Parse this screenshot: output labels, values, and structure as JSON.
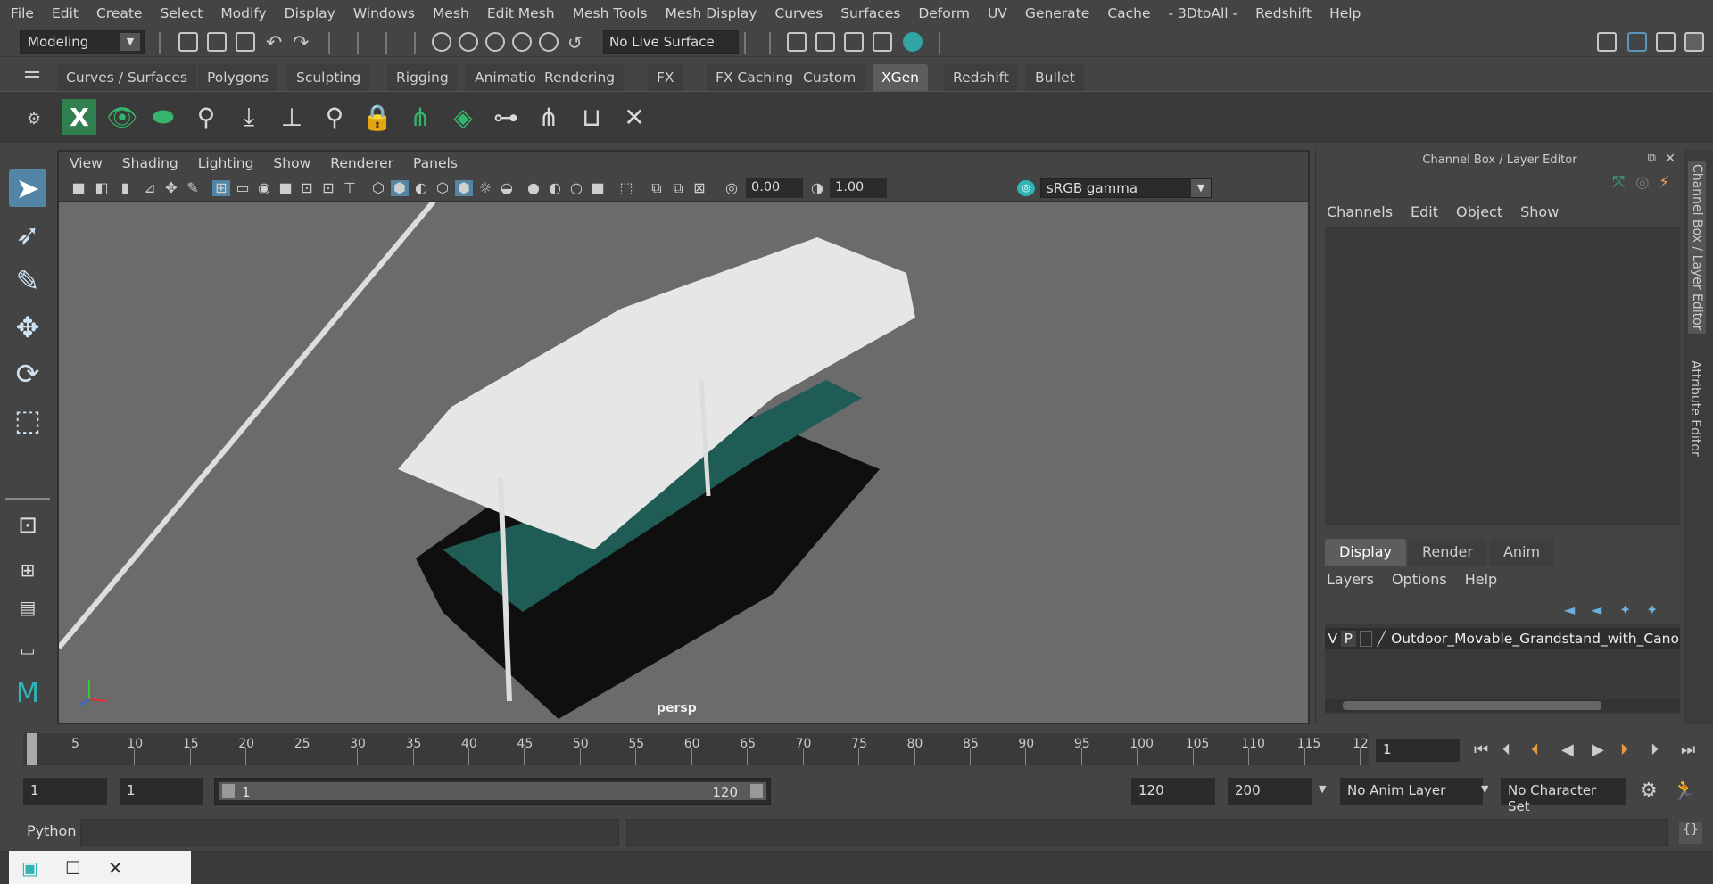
{
  "menubar": [
    "File",
    "Edit",
    "Create",
    "Select",
    "Modify",
    "Display",
    "Windows",
    "Mesh",
    "Edit Mesh",
    "Mesh Tools",
    "Mesh Display",
    "Curves",
    "Surfaces",
    "Deform",
    "UV",
    "Generate",
    "Cache",
    "- 3DtoAll -",
    "Redshift",
    "Help"
  ],
  "status": {
    "mode": "Modeling",
    "live_surface": "No Live Surface"
  },
  "shelf_tabs": [
    "Curves / Surfaces",
    "Polygons",
    "Sculpting",
    "Rigging",
    "Animation",
    "Rendering",
    "FX",
    "FX Caching",
    "Custom",
    "XGen",
    "Redshift",
    "Bullet"
  ],
  "shelf_active": "XGen",
  "viewport": {
    "menu": [
      "View",
      "Shading",
      "Lighting",
      "Show",
      "Renderer",
      "Panels"
    ],
    "exposure": "0.00",
    "gamma_value": "1.00",
    "color_space": "sRGB gamma",
    "camera": "persp"
  },
  "right_panel": {
    "title": "Channel Box / Layer Editor",
    "menu": [
      "Channels",
      "Edit",
      "Object",
      "Show"
    ],
    "display_tabs": [
      "Display",
      "Render",
      "Anim"
    ],
    "layer_menu": [
      "Layers",
      "Options",
      "Help"
    ],
    "layer": {
      "v": "V",
      "p": "P",
      "name": "Outdoor_Movable_Grandstand_with_Canop"
    },
    "side_tabs": [
      "Channel Box / Layer Editor",
      "Attribute Editor"
    ]
  },
  "timeline": {
    "labels": [
      "1",
      "5",
      "10",
      "15",
      "20",
      "25",
      "30",
      "35",
      "40",
      "45",
      "50",
      "55",
      "60",
      "65",
      "70",
      "75",
      "80",
      "85",
      "90",
      "95",
      "100",
      "105",
      "110",
      "115",
      "12"
    ],
    "current_frame": "1"
  },
  "range": {
    "start": "1",
    "playback_start": "1",
    "slider_start": "1",
    "slider_end": "120",
    "playback_end": "120",
    "end": "200",
    "anim_layer": "No Anim Layer",
    "character_set": "No Character Set"
  },
  "command": {
    "language": "Python"
  },
  "colors": {
    "accent": "#5285a6",
    "active_tab": "#5d5d5d",
    "viewport_bg": "#6b6b6b",
    "teal": "#2fb5b5"
  }
}
